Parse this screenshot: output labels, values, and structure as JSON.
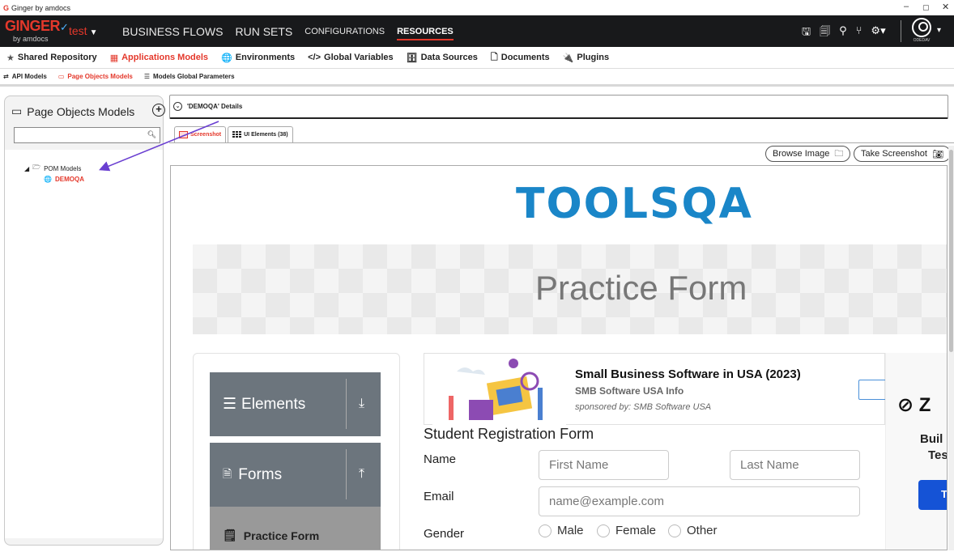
{
  "window": {
    "title": "Ginger by amdocs",
    "controls": [
      "–",
      "▢",
      "✕"
    ]
  },
  "brand": {
    "name": "GINGER",
    "sub": "by amdocs"
  },
  "project": {
    "name": "test"
  },
  "top_nav": {
    "items": [
      {
        "label": "BUSINESS FLOWS",
        "active": false
      },
      {
        "label": "RUN SETS",
        "active": false
      },
      {
        "label": "CONFIGURATIONS",
        "active": false
      },
      {
        "label": "RESOURCES",
        "active": true
      }
    ],
    "user_name": "ODEDAV"
  },
  "resources_bar": {
    "items": [
      {
        "label": "Shared Repository",
        "icon": "star-icon",
        "active": false
      },
      {
        "label": "Applications Models",
        "icon": "grid-icon",
        "active": true
      },
      {
        "label": "Environments",
        "icon": "globe-icon",
        "active": false
      },
      {
        "label": "Global Variables",
        "icon": "code-icon",
        "active": false
      },
      {
        "label": "Data Sources",
        "icon": "database-icon",
        "active": false
      },
      {
        "label": "Documents",
        "icon": "document-icon",
        "active": false
      },
      {
        "label": "Plugins",
        "icon": "plug-icon",
        "active": false
      }
    ]
  },
  "sub_bar": {
    "items": [
      {
        "label": "API Models",
        "active": false
      },
      {
        "label": "Page Objects Models",
        "active": true
      },
      {
        "label": "Models Global Parameters",
        "active": false
      }
    ]
  },
  "left_pane": {
    "title": "Page Objects Models",
    "search_value": "",
    "tree": {
      "root": "POM Models",
      "child": "DEMOQA"
    }
  },
  "details": {
    "title": "'DEMOQA' Details",
    "tabs": [
      {
        "label": "Screenshot",
        "active": true
      },
      {
        "label": "UI Elements (38)",
        "active": false
      }
    ],
    "browse_label": "Browse Image",
    "screenshot_label": "Take Screenshot"
  },
  "captured_page": {
    "logo": "TOOLSQA",
    "banner_title": "Practice Form",
    "menu": {
      "elements": "Elements",
      "forms": "Forms",
      "practice_form": "Practice Form"
    },
    "ad": {
      "title": "Small Business Software in USA (2023)",
      "subtitle": "SMB Software USA Info",
      "sponsor": "sponsored by: SMB Software USA"
    },
    "form_title": "Student Registration Form",
    "labels": {
      "name": "Name",
      "email": "Email",
      "gender": "Gender"
    },
    "placeholders": {
      "first": "First Name",
      "last": "Last Name",
      "email": "name@example.com"
    },
    "gender_options": [
      "Male",
      "Female",
      "Other"
    ],
    "side_ad": {
      "logo": "Z",
      "line1": "Buil",
      "line2": "Tes",
      "button": "Tr"
    }
  },
  "colors": {
    "accent": "#e4382b",
    "nav_bg": "#18191b",
    "toolsqa_blue": "#1a86c8",
    "menu_gray": "#6c757d"
  }
}
